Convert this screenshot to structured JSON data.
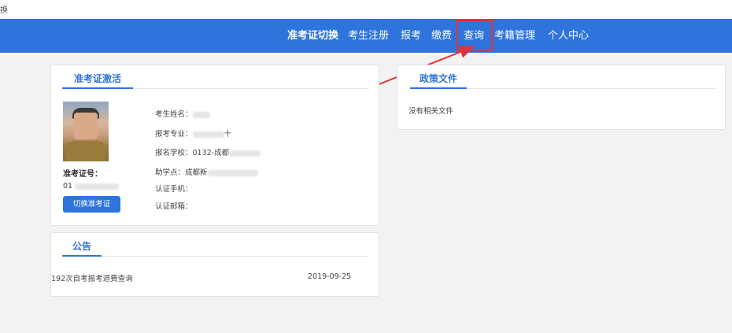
{
  "top_strip": {
    "glyph": "换"
  },
  "nav": {
    "items": [
      {
        "label": "准考证切换",
        "active": true
      },
      {
        "label": "考生注册"
      },
      {
        "label": "报考"
      },
      {
        "label": "缴费"
      },
      {
        "label": "查询"
      },
      {
        "label": "考籍管理"
      },
      {
        "label": "个人中心"
      }
    ]
  },
  "ticket_card": {
    "title": "准考证激活",
    "ticket_label": "准考证号：",
    "ticket_value_start": "01",
    "switch_button": "切换准考证",
    "fields": {
      "name_label": "考生姓名：",
      "major_label": "报考专业：",
      "major_value_tail": "十",
      "school_label": "报名学校：",
      "school_value": "0132-成都",
      "assist_label": "助学点：",
      "assist_value": "成都新",
      "phone_label": "认证手机：",
      "email_label": "认证邮箱："
    }
  },
  "policy_card": {
    "title": "政策文件",
    "empty_text": "没有相关文件"
  },
  "notice_card": {
    "title": "公告",
    "items": [
      {
        "title": "192次自考报考退费查询",
        "date": "2019-09-25"
      }
    ]
  },
  "colors": {
    "nav_bg": "#2e74dc",
    "accent": "#2e74dc",
    "callout": "#e23232"
  },
  "icons": [
    "user-photo"
  ]
}
